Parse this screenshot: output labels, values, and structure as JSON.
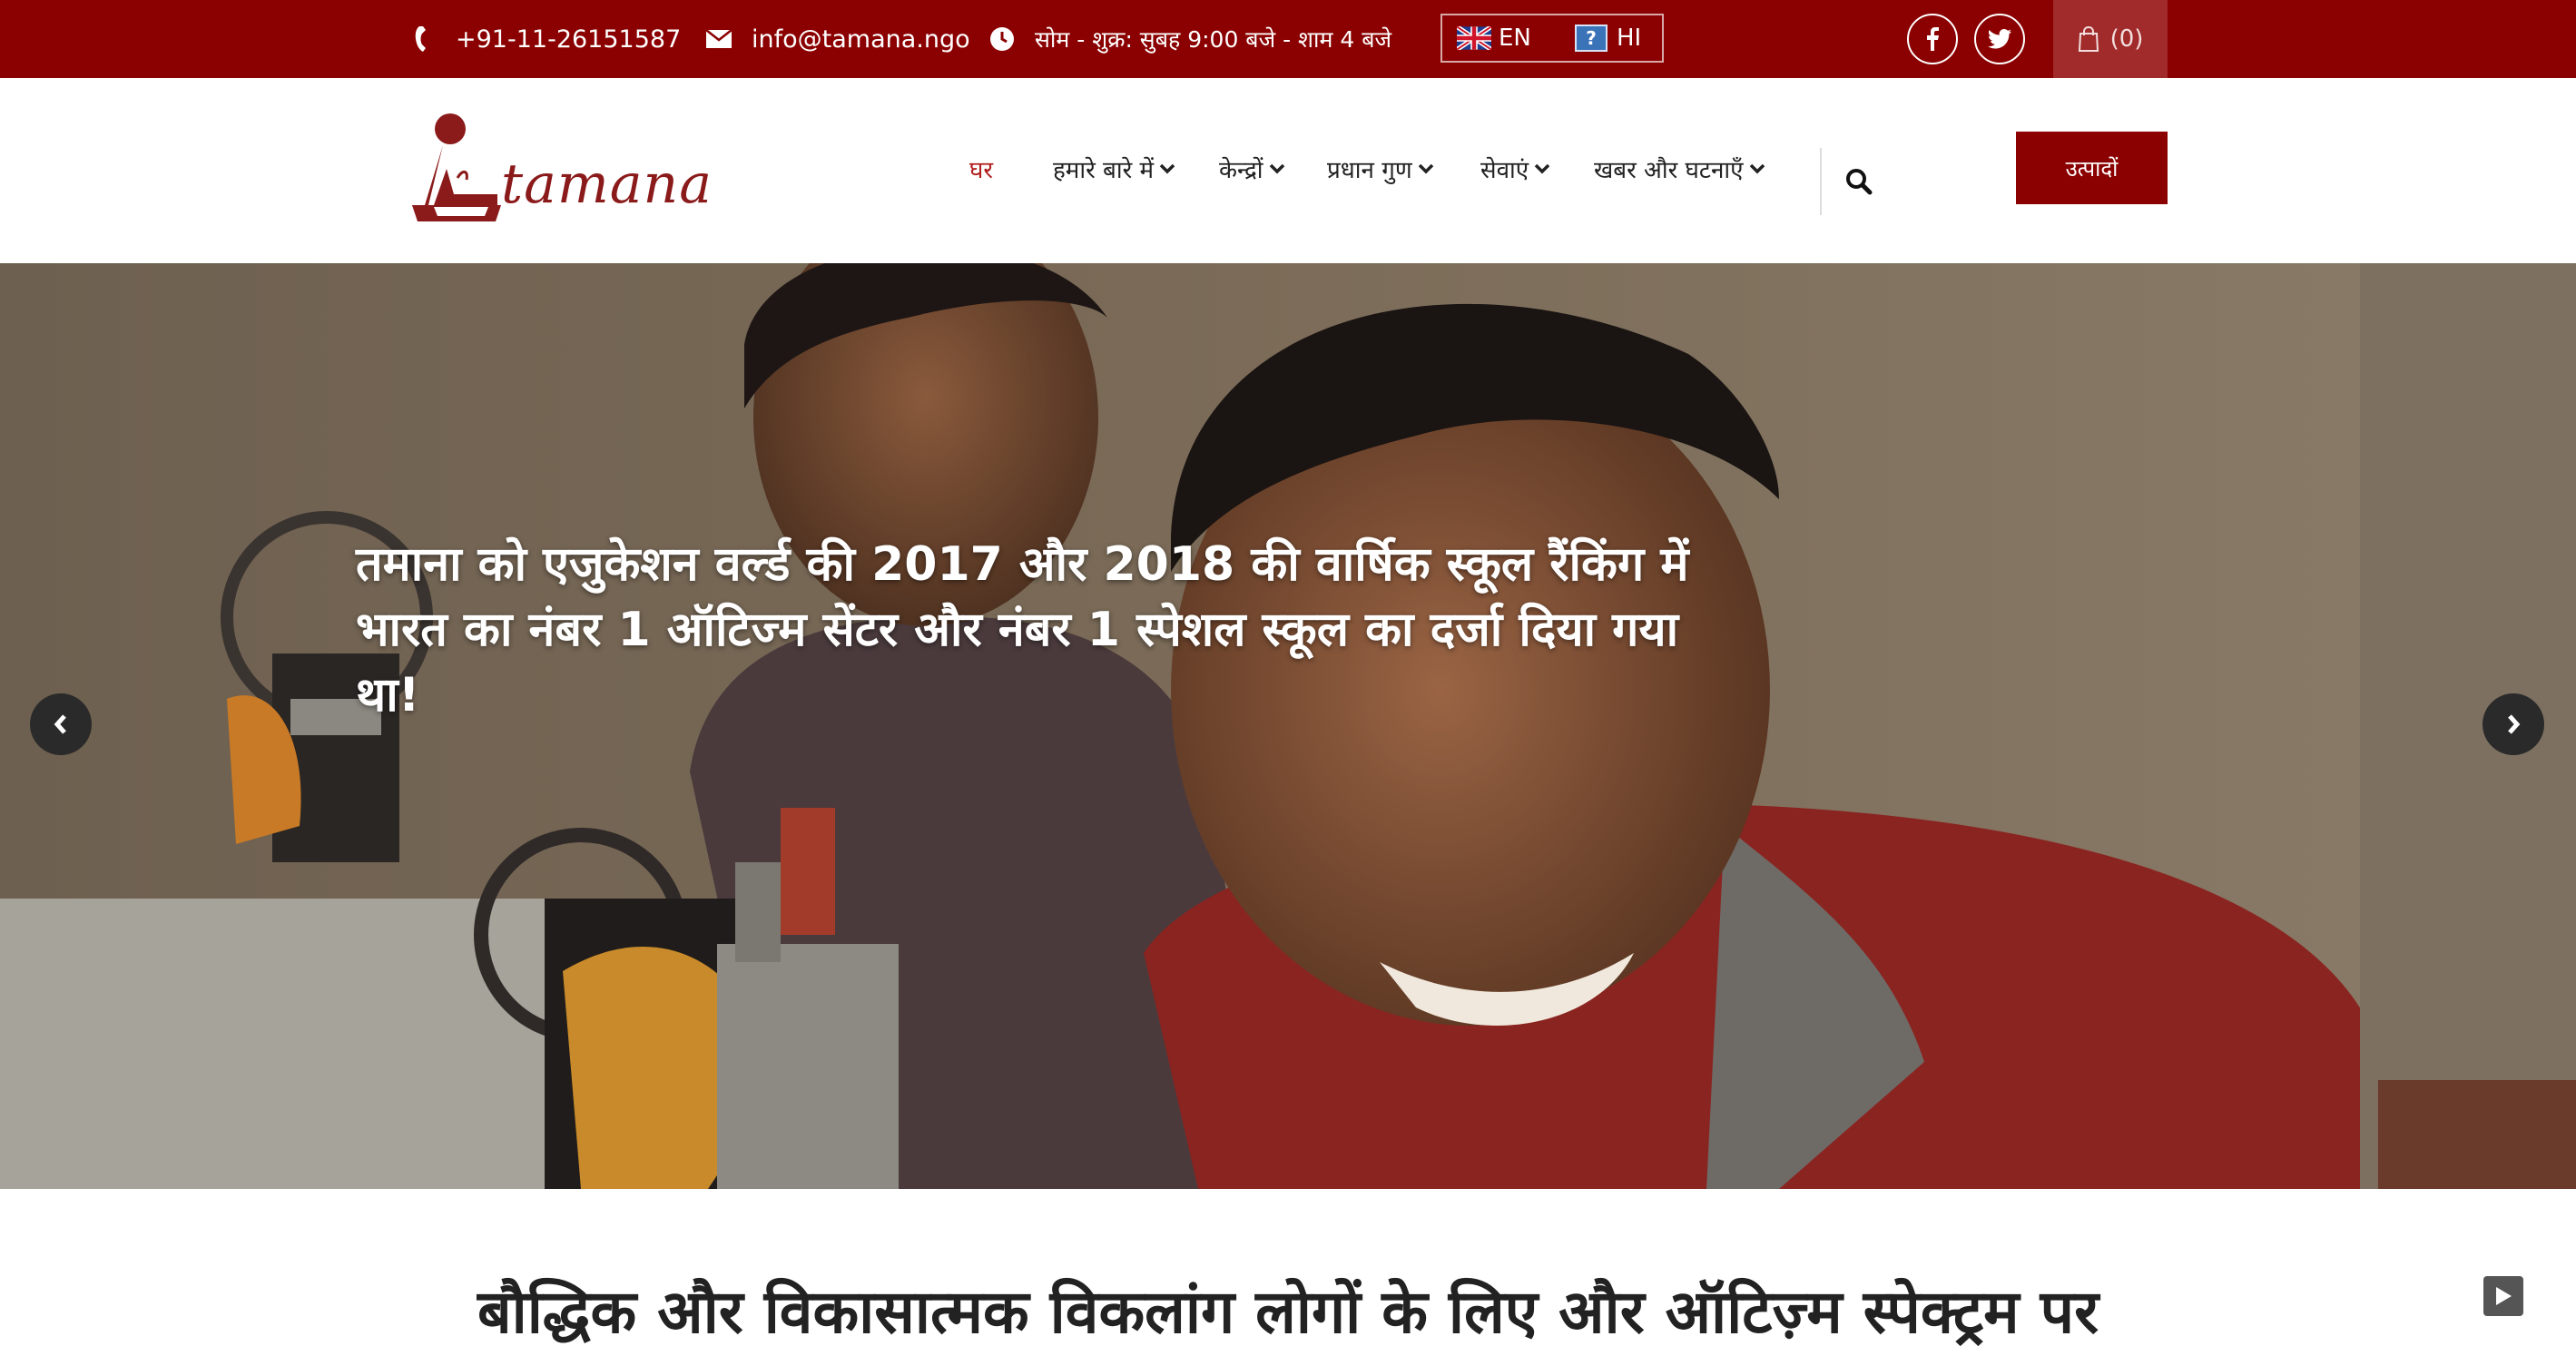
{
  "topbar": {
    "phone": "+91-11-26151587",
    "email": "info@tamana.ngo",
    "hours": "सोम - शुक्र: सुबह 9:00 बजे - शाम 4 बजे",
    "languages": [
      {
        "code": "EN",
        "icon": "uk-flag-icon"
      },
      {
        "code": "HI",
        "icon": "question-flag-icon"
      }
    ],
    "social": [
      "facebook-icon",
      "twitter-icon"
    ],
    "cart_count": "(0)"
  },
  "header": {
    "logo_text": "tamana",
    "nav": [
      {
        "label": "घर",
        "active": true,
        "dropdown": false
      },
      {
        "label": "हमारे बारे में",
        "active": false,
        "dropdown": true
      },
      {
        "label": "केन्द्रों",
        "active": false,
        "dropdown": true
      },
      {
        "label": "प्रधान गुण",
        "active": false,
        "dropdown": true
      },
      {
        "label": "सेवाएं",
        "active": false,
        "dropdown": true
      },
      {
        "label": "खबर और घटनाएँ",
        "active": false,
        "dropdown": true
      }
    ],
    "products_button": "उत्पादों"
  },
  "hero": {
    "caption_lines": [
      "तमाना को एजुकेशन वर्ल्ड की 2017 और 2018 की वार्षिक स्कूल रैंकिंग में",
      "भारत का नंबर 1 ऑटिज्म सेंटर और नंबर 1 स्पेशल स्कूल का दर्जा दिया गया",
      "था!"
    ]
  },
  "main": {
    "heading": "बौद्धिक और विकासात्मक विकलांग लोगों के लिए और ऑटिज़्म स्पेक्ट्रम पर"
  },
  "colors": {
    "brand": "#8b0000",
    "active_nav": "#b01e1e"
  }
}
